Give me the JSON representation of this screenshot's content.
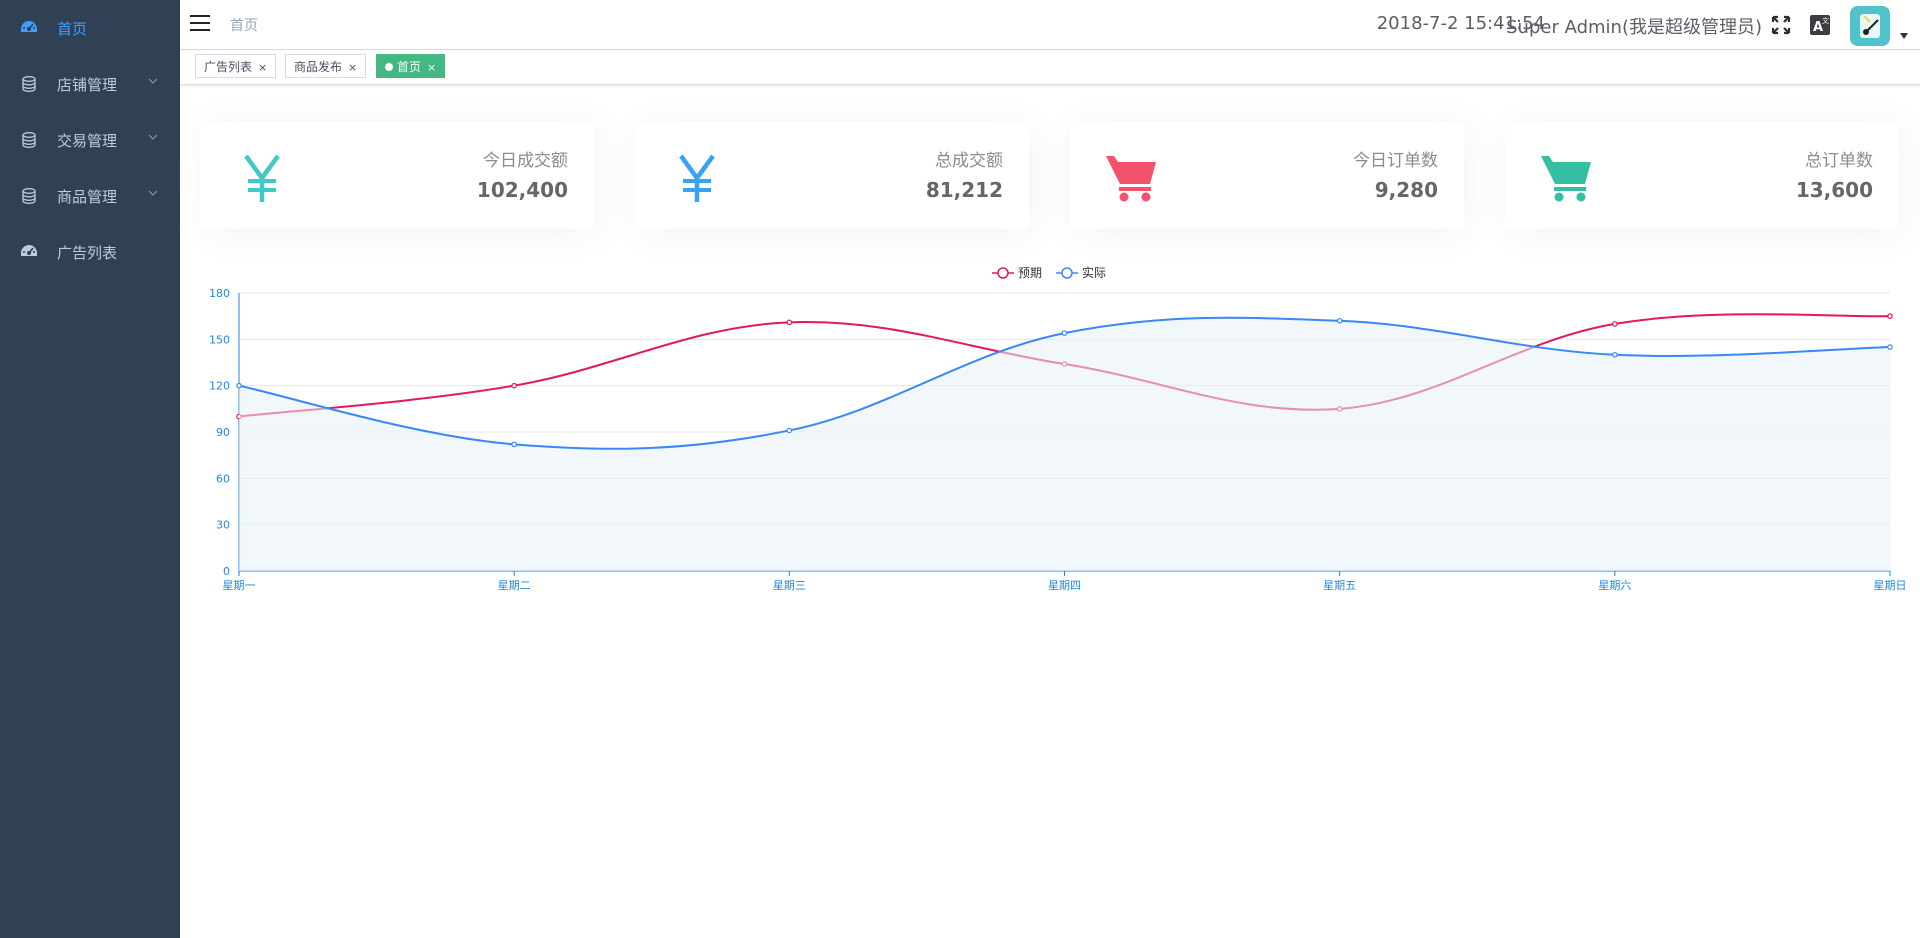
{
  "sidebar": {
    "items": [
      {
        "label": "首页",
        "icon": "dashboard-icon",
        "active": true,
        "has_submenu": false
      },
      {
        "label": "店铺管理",
        "icon": "database-icon",
        "active": false,
        "has_submenu": true
      },
      {
        "label": "交易管理",
        "icon": "database-icon",
        "active": false,
        "has_submenu": true
      },
      {
        "label": "商品管理",
        "icon": "database-icon",
        "active": false,
        "has_submenu": true
      },
      {
        "label": "广告列表",
        "icon": "dashboard-icon",
        "active": false,
        "has_submenu": false
      }
    ]
  },
  "navbar": {
    "breadcrumb": "首页",
    "datetime": "2018-7-2 15:41:54",
    "username": "Super Admin(我是超级管理员)"
  },
  "tags": [
    {
      "label": "广告列表",
      "active": false
    },
    {
      "label": "商品发布",
      "active": false
    },
    {
      "label": "首页",
      "active": true
    }
  ],
  "tag_close_glyph": "×",
  "cards": [
    {
      "title": "今日成交额",
      "value": "102,400",
      "icon": "yen-icon",
      "color": "#40c9c6"
    },
    {
      "title": "总成交额",
      "value": "81,212",
      "icon": "yen-icon",
      "color": "#36a3f7"
    },
    {
      "title": "今日订单数",
      "value": "9,280",
      "icon": "shopping-cart-icon",
      "color": "#f4516c"
    },
    {
      "title": "总订单数",
      "value": "13,600",
      "icon": "shopping-cart-icon",
      "color": "#34bfa3"
    }
  ],
  "colors": {
    "sidebar_bg": "#304156",
    "sidebar_active": "#409eff",
    "tag_active": "#42b983",
    "expected_line": "#e6175c",
    "actual_line": "#3888fa"
  },
  "chart_data": {
    "type": "line",
    "categories": [
      "星期一",
      "星期二",
      "星期三",
      "星期四",
      "星期五",
      "星期六",
      "星期日"
    ],
    "series": [
      {
        "name": "预期",
        "values": [
          100,
          120,
          161,
          134,
          105,
          160,
          165
        ],
        "color": "#e6175c",
        "smooth": true
      },
      {
        "name": "实际",
        "values": [
          120,
          82,
          91,
          154,
          162,
          140,
          145
        ],
        "color": "#3888fa",
        "smooth": true,
        "area": true
      }
    ],
    "ylim": [
      0,
      180
    ],
    "yticks": [
      0,
      30,
      60,
      90,
      120,
      150,
      180
    ],
    "legend_position": "top-center",
    "grid": true
  }
}
